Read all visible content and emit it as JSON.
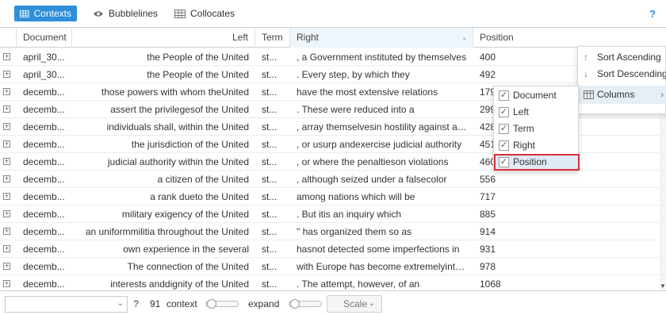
{
  "toolbar": {
    "tabs": [
      {
        "label": "Contexts",
        "icon": "grid-icon",
        "active": true
      },
      {
        "label": "Bubblelines",
        "icon": "eye-icon",
        "active": false
      },
      {
        "label": "Collocates",
        "icon": "grid-icon",
        "active": false
      }
    ],
    "help": "?"
  },
  "columns": {
    "document": "Document",
    "left": "Left",
    "term": "Term",
    "right": "Right",
    "position": "Position"
  },
  "rows": [
    {
      "document": "april_30...",
      "left": "the People of the United",
      "term": "st...",
      "right": ", a Government instituted by themselves",
      "position": "400"
    },
    {
      "document": "april_30...",
      "left": "the People of the United",
      "term": "st...",
      "right": ". Every step, by which they",
      "position": "492"
    },
    {
      "document": "decemb...",
      "left": "those powers with whom theUnited",
      "term": "st...",
      "right": "have the most extensive relations",
      "position": "179"
    },
    {
      "document": "decemb...",
      "left": "assert the privilegesof the United",
      "term": "st...",
      "right": ". These were reduced into a",
      "position": "299"
    },
    {
      "document": "decemb...",
      "left": "individuals shall, within the United",
      "term": "st...",
      "right": ", array themselvesin hostility against any",
      "position": "428"
    },
    {
      "document": "decemb...",
      "left": "the jurisdiction of the United",
      "term": "st...",
      "right": ", or usurp andexercise judicial authority",
      "position": "451"
    },
    {
      "document": "decemb...",
      "left": "judicial authority within the United",
      "term": "st...",
      "right": ", or where the penaltieson violations",
      "position": "460"
    },
    {
      "document": "decemb...",
      "left": "a citizen of the United",
      "term": "st...",
      "right": ", although seized under a falsecolor",
      "position": "556"
    },
    {
      "document": "decemb...",
      "left": "a rank dueto the United",
      "term": "st...",
      "right": "among nations which will be",
      "position": "717"
    },
    {
      "document": "decemb...",
      "left": "military exigency of the United",
      "term": "st...",
      "right": ". But itis an inquiry which",
      "position": "885"
    },
    {
      "document": "decemb...",
      "left": "an uniformmilitia throughout the United",
      "term": "st...",
      "right": "\" has organized them so as",
      "position": "914"
    },
    {
      "document": "decemb...",
      "left": "own experience in the several",
      "term": "st...",
      "right": "hasnot detected some imperfections in",
      "position": "931"
    },
    {
      "document": "decemb...",
      "left": "The connection of the United",
      "term": "st...",
      "right": "with Europe has become extremelyinter...",
      "position": "978"
    },
    {
      "document": "decemb...",
      "left": "interests anddignity of the United",
      "term": "st...",
      "right": ". The attempt, however, of an",
      "position": "1068"
    }
  ],
  "footer": {
    "count": "91",
    "context_label": "context",
    "expand_label": "expand",
    "scale_label": "Scale",
    "help": "?"
  },
  "menu": {
    "sort_asc": "Sort Ascending",
    "sort_desc": "Sort Descending",
    "columns": "Columns"
  },
  "submenu": [
    {
      "label": "Document",
      "checked": true
    },
    {
      "label": "Left",
      "checked": true
    },
    {
      "label": "Term",
      "checked": true
    },
    {
      "label": "Right",
      "checked": true
    },
    {
      "label": "Position",
      "checked": true
    }
  ],
  "colors": {
    "accent": "#2f8fd8",
    "highlight_outline": "#d9303a"
  }
}
